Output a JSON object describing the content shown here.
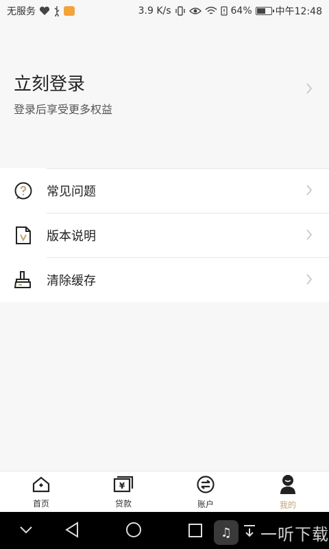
{
  "status_bar": {
    "carrier": "无服务",
    "speed": "3.9 K/s",
    "battery": "64%",
    "battery_level": 0.64,
    "time": "中午12:48"
  },
  "login": {
    "title": "立刻登录",
    "subtitle": "登录后享受更多权益"
  },
  "menu": {
    "items": [
      {
        "label": "常见问题",
        "icon": "question-icon"
      },
      {
        "label": "版本说明",
        "icon": "version-doc-icon"
      },
      {
        "label": "清除缓存",
        "icon": "broom-icon"
      }
    ]
  },
  "bottom_nav": {
    "items": [
      {
        "label": "首页",
        "icon": "home-icon"
      },
      {
        "label": "贷款",
        "icon": "loan-icon"
      },
      {
        "label": "账户",
        "icon": "account-icon"
      },
      {
        "label": "我的",
        "icon": "profile-icon",
        "active": true
      }
    ]
  },
  "colors": {
    "accent": "#bfa57a",
    "background": "#f7f7f7"
  },
  "watermark": {
    "text": "一听下载"
  }
}
